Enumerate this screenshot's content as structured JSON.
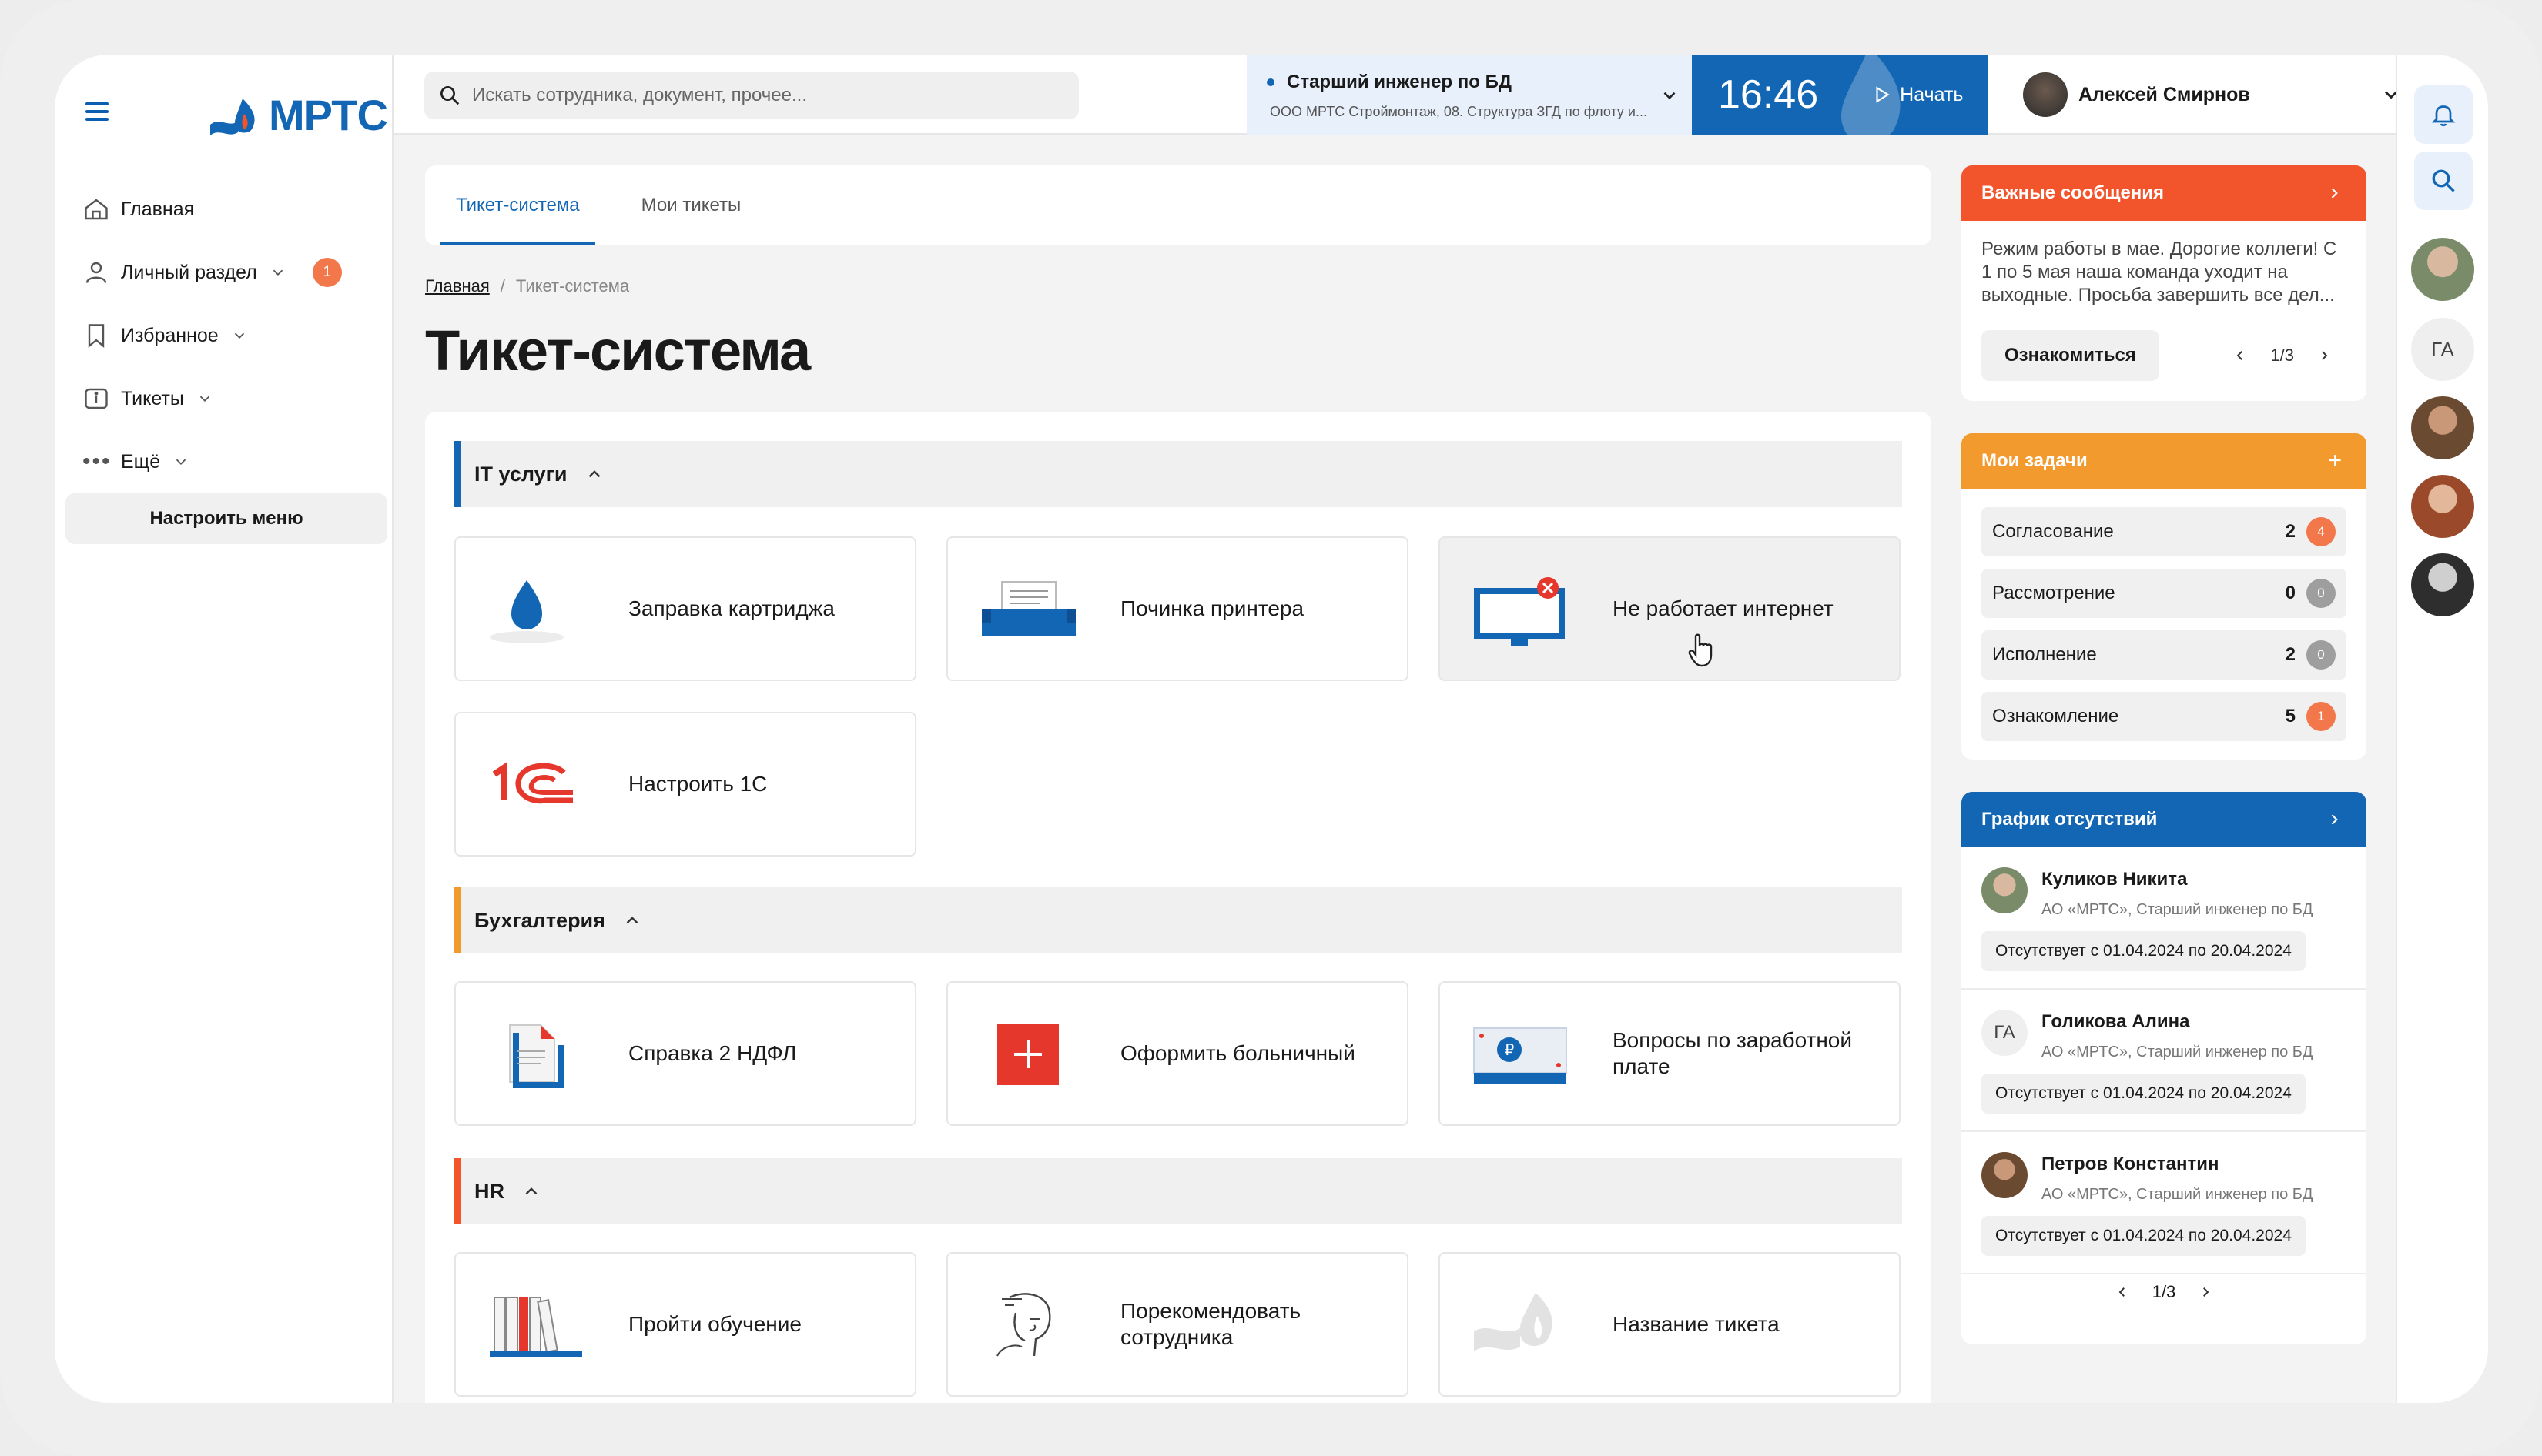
{
  "sidebar": {
    "logo_text": "МРТС",
    "items": [
      {
        "label": "Главная"
      },
      {
        "label": "Личный раздел",
        "badge": "1"
      },
      {
        "label": "Избранное"
      },
      {
        "label": "Тикеты"
      },
      {
        "label": "Ещё"
      }
    ],
    "setup_menu": "Настроить меню"
  },
  "topbar": {
    "search_placeholder": "Искать сотрудника, документ, прочее...",
    "position_title": "Старший инженер по БД",
    "position_sub": "ООО МРТС Строймонтаж, 08. Структура ЗГД по флоту и...",
    "clock": "16:46",
    "start_label": "Начать",
    "user_name": "Алексей Смирнов"
  },
  "tabs": [
    {
      "label": "Тикет-система",
      "active": true
    },
    {
      "label": "Мои тикеты",
      "active": false
    }
  ],
  "breadcrumb": {
    "home": "Главная",
    "current": "Тикет-система"
  },
  "page_title": "Тикет-система",
  "sections": [
    {
      "title": "IT услуги",
      "color": "#1266b3",
      "cards": [
        "Заправка картриджа",
        "Починка принтера",
        "Не работает интернет",
        "Настроить 1С"
      ]
    },
    {
      "title": "Бухгалтерия",
      "color": "#f29a2e",
      "cards": [
        "Справка 2 НДФЛ",
        "Оформить больничный",
        "Вопросы по заработной плате"
      ]
    },
    {
      "title": "HR",
      "color": "#f2552c",
      "cards": [
        "Пройти обучение",
        "Порекомендовать сотрудника",
        "Название тикета"
      ]
    }
  ],
  "important": {
    "title": "Важные сообщения",
    "color": "#f2552c",
    "text": "Режим работы в мае. Дорогие коллеги! С 1 по 5 мая наша команда уходит на выходные. Просьба завершить все дел...",
    "button": "Ознакомиться",
    "pager": "1/3"
  },
  "tasks": {
    "title": "Мои задачи",
    "color": "#f29a2e",
    "add": "+",
    "rows": [
      {
        "label": "Согласование",
        "count": "2",
        "badge": "4",
        "badge_color": "#f2784b"
      },
      {
        "label": "Рассмотрение",
        "count": "0",
        "badge": "0",
        "badge_color": "#9e9e9e"
      },
      {
        "label": "Исполнение",
        "count": "2",
        "badge": "0",
        "badge_color": "#9e9e9e"
      },
      {
        "label": "Ознакомление",
        "count": "5",
        "badge": "1",
        "badge_color": "#f2784b"
      }
    ]
  },
  "absences": {
    "title": "График отсутствий",
    "color": "#1266b3",
    "people": [
      {
        "name": "Куликов Никита",
        "org": "АО «МРТС», Старший инженер по БД",
        "dates": "Отсутствует с 01.04.2024 по 20.04.2024",
        "initials": ""
      },
      {
        "name": "Голикова Алина",
        "org": "АО «МРТС», Старший инженер по БД",
        "dates": "Отсутствует с 01.04.2024 по 20.04.2024",
        "initials": "ГА"
      },
      {
        "name": "Петров Константин",
        "org": "АО «МРТС», Старший инженер по БД",
        "dates": "Отсутствует с 01.04.2024 по 20.04.2024",
        "initials": ""
      }
    ],
    "pager": "1/3"
  },
  "rail": {
    "initials": "ГА"
  }
}
